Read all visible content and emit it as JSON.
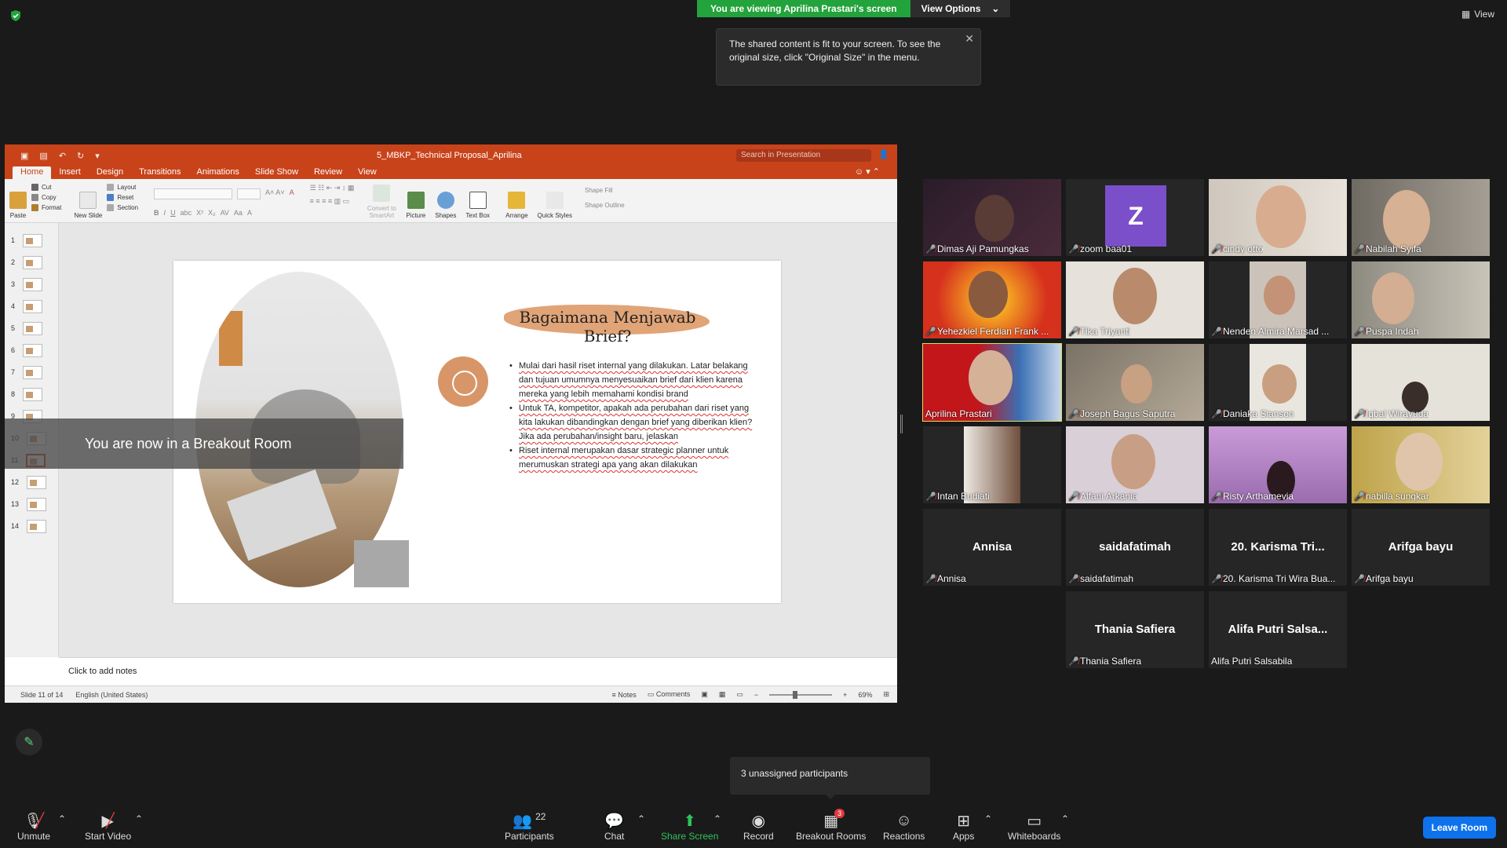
{
  "top": {
    "share_banner": "You are viewing Aprilina Prastari's screen",
    "view_options": "View Options",
    "tooltip": "The shared content is fit to your screen. To see the original size, click \"Original Size\" in the menu.",
    "view_label": "View"
  },
  "ppt": {
    "file_name": "5_MBKP_Technical Proposal_Aprilina",
    "search_placeholder": "Search in Presentation",
    "tabs": [
      "Home",
      "Insert",
      "Design",
      "Transitions",
      "Animations",
      "Slide Show",
      "Review",
      "View"
    ],
    "ribbon": {
      "paste": "Paste",
      "cut": "Cut",
      "copy": "Copy",
      "format": "Format",
      "new_slide": "New Slide",
      "layout": "Layout",
      "reset": "Reset",
      "section": "Section",
      "convert": "Convert to SmartArt",
      "picture": "Picture",
      "shapes": "Shapes",
      "text_box": "Text Box",
      "arrange": "Arrange",
      "quick_styles": "Quick Styles",
      "shape_fill": "Shape Fill",
      "shape_outline": "Shape Outline"
    },
    "thumbnails": [
      "1",
      "2",
      "3",
      "4",
      "5",
      "6",
      "7",
      "8",
      "9",
      "10",
      "11",
      "12",
      "13",
      "14"
    ],
    "slide": {
      "title": "Bagaimana Menjawab Brief?",
      "bullets": [
        "Mulai dari hasil riset internal yang dilakukan. Latar belakang  dan tujuan umumnya menyesuaikan brief dari klien karena mereka yang lebih memahami kondisi brand",
        "Untuk TA, kompetitor, apakah ada perubahan dari riset yang kita lakukan dibandingkan dengan brief yang diberikan klien? Jika ada perubahan/insight baru, jelaskan",
        "Riset internal merupakan dasar strategic planner untuk merumuskan strategi apa yang akan dilakukan"
      ]
    },
    "notes": "Click to add notes",
    "status": {
      "slide": "Slide 11 of 14",
      "language": "English (United States)",
      "notes": "Notes",
      "comments": "Comments",
      "zoom": "69%"
    }
  },
  "breakout_message": "You are now in a Breakout Room",
  "participants": [
    {
      "name": "Dimas Aji Pamungkas",
      "video": true
    },
    {
      "name": "zoom baa01",
      "video": false,
      "avatar": "Z"
    },
    {
      "name": "cindy otto",
      "video": true
    },
    {
      "name": "Nabilah Syifa",
      "video": true
    },
    {
      "name": "Yehezkiel Ferdian Frank ...",
      "video": true
    },
    {
      "name": "Tika Triyanti",
      "video": true
    },
    {
      "name": "Nenden Almira Marsad ...",
      "video": true
    },
    {
      "name": "Puspa Indah",
      "video": true
    },
    {
      "name": "Aprilina Prastari",
      "video": true,
      "active": true
    },
    {
      "name": "Joseph Bagus Saputra",
      "video": true
    },
    {
      "name": "Daniaka Sianson",
      "video": true
    },
    {
      "name": "Iqbal Wirayuda",
      "video": true
    },
    {
      "name": "Intan Budiati",
      "video": true
    },
    {
      "name": "Alfani Arkania",
      "video": true
    },
    {
      "name": "Risty Arthamevia",
      "video": true
    },
    {
      "name": "nabilla sungkar",
      "video": true
    },
    {
      "name": "Annisa",
      "video": false,
      "big": "Annisa"
    },
    {
      "name": "saidafatimah",
      "video": false,
      "big": "saidafatimah"
    },
    {
      "name": "20. Karisma Tri Wira Bua...",
      "video": false,
      "big": "20. Karisma Tri..."
    },
    {
      "name": "Arifga bayu",
      "video": false,
      "big": "Arifga bayu"
    },
    {
      "name": "Thania Safiera",
      "video": false,
      "big": "Thania Safiera"
    },
    {
      "name": "Alifa Putri Salsabila",
      "video": false,
      "big": "Alifa Putri Salsa...",
      "unmuted": true
    }
  ],
  "unassigned": "3 unassigned participants",
  "toolbar": {
    "unmute": "Unmute",
    "start_video": "Start Video",
    "participants": "Participants",
    "participants_count": "22",
    "chat": "Chat",
    "share_screen": "Share Screen",
    "record": "Record",
    "breakout_rooms": "Breakout Rooms",
    "breakout_badge": "3",
    "reactions": "Reactions",
    "apps": "Apps",
    "whiteboards": "Whiteboards",
    "leave": "Leave Room"
  }
}
